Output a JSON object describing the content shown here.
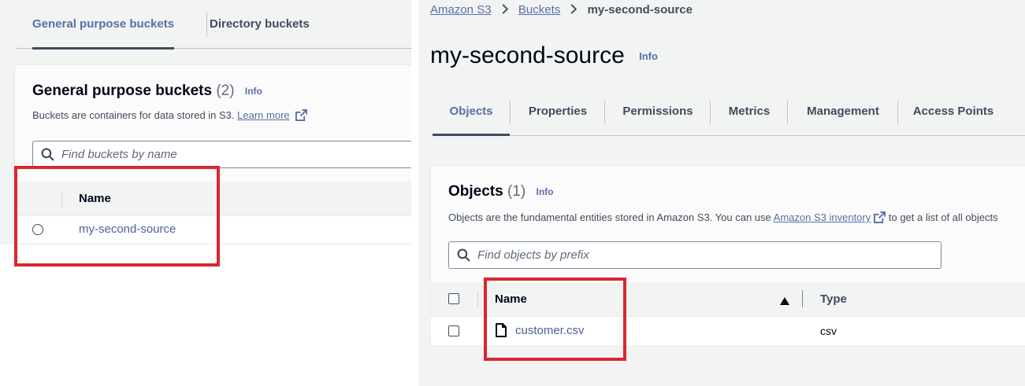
{
  "left": {
    "tabs": [
      {
        "label": "General purpose buckets",
        "active": true
      },
      {
        "label": "Directory buckets",
        "active": false
      }
    ],
    "card": {
      "title": "General purpose buckets",
      "count": "(2)",
      "info": "Info",
      "description": "Buckets are containers for data stored in S3.",
      "learn_more": "Learn more",
      "search_placeholder": "Find buckets by name",
      "column_name": "Name",
      "rows": [
        {
          "name": "my-second-source",
          "selected": false
        }
      ]
    }
  },
  "right": {
    "breadcrumb": {
      "items": [
        "Amazon S3",
        "Buckets"
      ],
      "current": "my-second-source"
    },
    "page_title": "my-second-source",
    "title_info": "Info",
    "tabs": [
      "Objects",
      "Properties",
      "Permissions",
      "Metrics",
      "Management",
      "Access Points"
    ],
    "active_tab": "Objects",
    "objects_card": {
      "title": "Objects",
      "count": "(1)",
      "info": "Info",
      "description_before": "Objects are the fundamental entities stored in Amazon S3. You can use",
      "description_link": "Amazon S3 inventory",
      "description_after": "to get a list of all objects",
      "search_placeholder": "Find objects by prefix",
      "column_name": "Name",
      "column_type": "Type",
      "rows": [
        {
          "name": "customer.csv",
          "type": "csv",
          "checked": false
        }
      ]
    }
  },
  "colors": {
    "link": "#5a6fa5",
    "highlight": "#d9262f",
    "background": "#f2f3f3"
  },
  "icons": [
    "search-icon",
    "external-link-icon",
    "chevron-right-icon",
    "sort-ascending-icon",
    "file-icon"
  ]
}
